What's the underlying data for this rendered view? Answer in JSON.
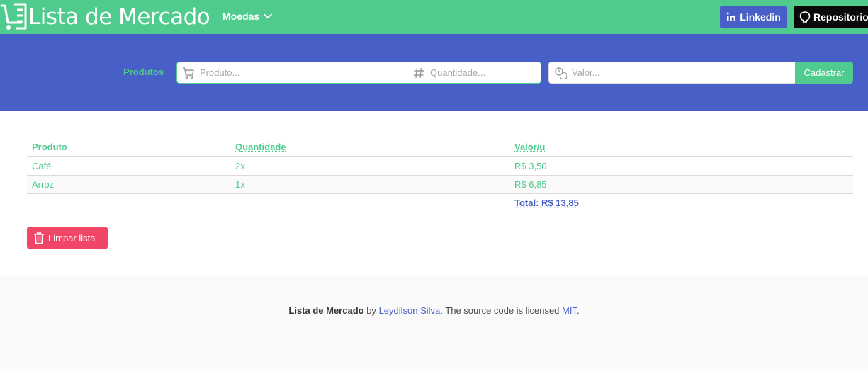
{
  "navbar": {
    "title": "Lista de Mercado",
    "dropdown_label": "Moedas",
    "linkedin_label": "Linkedin",
    "repo_label": "Repositorio",
    "color": "#4ecb8d"
  },
  "form": {
    "label": "Produtos",
    "produto_placeholder": "Produto...",
    "quantidade_placeholder": "Quantidade...",
    "valor_placeholder": "Valor...",
    "submit_label": "Cadastrar"
  },
  "table": {
    "headers": [
      "Produto",
      "Quantidade",
      "Valor/u"
    ],
    "rows": [
      {
        "produto": "Café",
        "quantidade": "2x",
        "valor": "R$ 3,50"
      },
      {
        "produto": "Arroz",
        "quantidade": "1x",
        "valor": "R$ 6,85"
      }
    ],
    "total": "Total: R$ 13,85"
  },
  "clear_button": "Limpar lista",
  "footer": {
    "app_name": "Lista de Mercado",
    "by": " by ",
    "author": "Leydilson Silva",
    "middle": ". The source code is licensed ",
    "license": "MIT",
    "end": "."
  },
  "colors": {
    "primary": "#4ecb8d",
    "hero": "#485fc7",
    "danger": "#f14668",
    "dark": "#0a0a0a"
  }
}
